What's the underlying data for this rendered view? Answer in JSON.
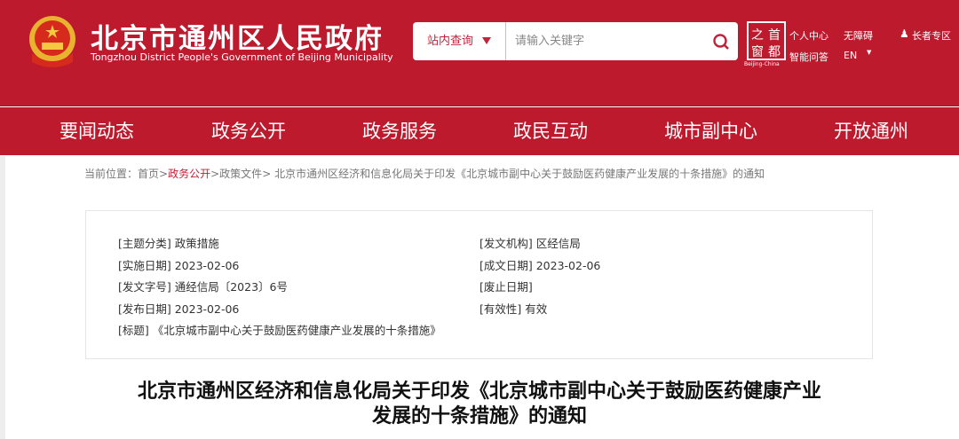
{
  "header": {
    "title": "北京市通州区人民政府",
    "subtitle": "Tongzhou District People's Government of Beijing Municipality",
    "search": {
      "scope": "站内查询",
      "placeholder": "请输入关键字"
    },
    "capital_logo": {
      "chars": [
        "之",
        "首",
        "窗",
        "都"
      ],
      "caption": "Beijing-China"
    },
    "links": {
      "personal": "个人中心",
      "accessible": "无障碍",
      "qa": "智能问答",
      "lang": "EN",
      "elder": "长者专区"
    }
  },
  "nav": [
    "要闻动态",
    "政务公开",
    "政务服务",
    "政民互动",
    "城市副中心",
    "开放通州"
  ],
  "breadcrumb": {
    "prefix": "当前位置：",
    "home": "首页",
    "sep": ">",
    "section": "政务公开",
    "sub": "政策文件",
    "current": "北京市通州区经济和信息化局关于印发《北京城市副中心关于鼓励医药健康产业发展的十条措施》的通知"
  },
  "meta": {
    "category": "[主题分类] 政策措施",
    "issuer": "[发文机构] 区经信局",
    "effective": "[实施日期] 2023-02-06",
    "written": "[成文日期] 2023-02-06",
    "docno": "[发文字号] 通经信局〔2023〕6号",
    "abolish": "[废止日期]",
    "published": "[发布日期] 2023-02-06",
    "validity": "[有效性] 有效",
    "title": "[标题] 《北京城市副中心关于鼓励医药健康产业发展的十条措施》"
  },
  "article": {
    "title_line1": "北京市通州区经济和信息化局关于印发《北京城市副中心关于鼓励医药健康产业",
    "title_line2": "发展的十条措施》的通知"
  }
}
